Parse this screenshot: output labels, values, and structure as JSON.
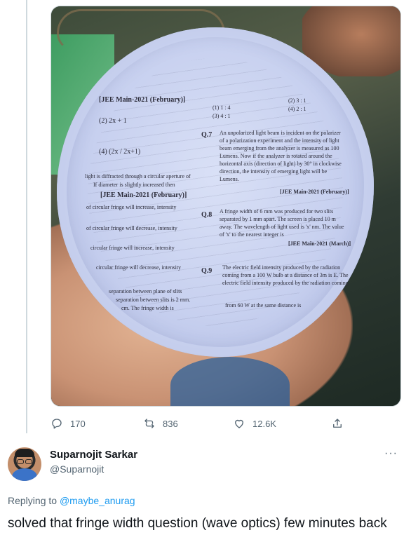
{
  "tweet": {
    "media": {
      "alt": "",
      "plate_text": {
        "header_1": "[JEE Main-2021 (February)]",
        "header_2": "[JEE Main-2021 (February)]",
        "header_3": "[JEE Main-2021 (February)]",
        "header_4": "[JEE Main-2021 (March)]",
        "q7": "Q.7",
        "q8": "Q.8",
        "q9": "Q.9",
        "opt_a": "(1) 1 : 4",
        "opt_b": "(3) 4 : 1",
        "opt_c": "(2) 3 : 1",
        "opt_d": "(4) 2 : 1",
        "q7_l1": "An unpolarized light beam is incident on the polarizer",
        "q7_l2": "of a polarization experiment and the intensity of light",
        "q7_l3": "beam emerging from the analyzer is measured as 100",
        "q7_l4": "Lumens. Now if the analyzer is rotated around the",
        "q7_l5": "horizontal axis (direction of light) by 30° in clockwise",
        "q7_l6": "direction, the intensity of emerging light will be",
        "q7_l7": "Lumens.",
        "q8_l1": "A fringe width of 6 mm was produced for two slits",
        "q8_l2": "separated by 1 mm apart. The screen is placed 10 m",
        "q8_l3": "away. The wavelength of light used is 'x' nm. The value",
        "q8_l4": "of 'x' to the nearest integer is",
        "q9_l1": "The electric field intensity produced by the radiation",
        "q9_l2": "coming from a 100 W bulb at a distance of 3m is E. The",
        "q9_l3": "electric field intensity produced by the radiation coming",
        "q9_l4": "from 60 W at the same distance is",
        "left_l1": "light is diffracted through a circular aperture of",
        "left_l2": "If diameter is slightly increased then",
        "left_l3": "of circular fringe will increase, intensity",
        "left_l4": "of circular fringe will decrease, intensity",
        "left_l5": "circular fringe will increase, intensity",
        "left_l6": "circular fringe will decrease, intensity",
        "left_l7": "separation between plane of slits",
        "left_l8": "separation between slits is 2 mm.",
        "left_l9": "cm. The fringe width is",
        "eq1": "(2) 2x + 1",
        "eq2": "(4) (2x / 2x+1)"
      }
    },
    "actions": {
      "replies": "170",
      "retweets": "836",
      "likes": "12.6K"
    }
  },
  "reply": {
    "author_name": "Suparnojit Sarkar",
    "author_handle": "@Suparnojit",
    "more_label": "···",
    "replying_prefix": "Replying to",
    "replying_to": "@maybe_anurag",
    "text": "solved that fringe width question (wave optics) few minutes back"
  },
  "colors": {
    "accent": "#1d9bf0",
    "secondary_text": "#536471",
    "border": "#cfd9de"
  },
  "icons": [
    "reply-icon",
    "retweet-icon",
    "like-icon",
    "share-icon",
    "more-icon"
  ]
}
